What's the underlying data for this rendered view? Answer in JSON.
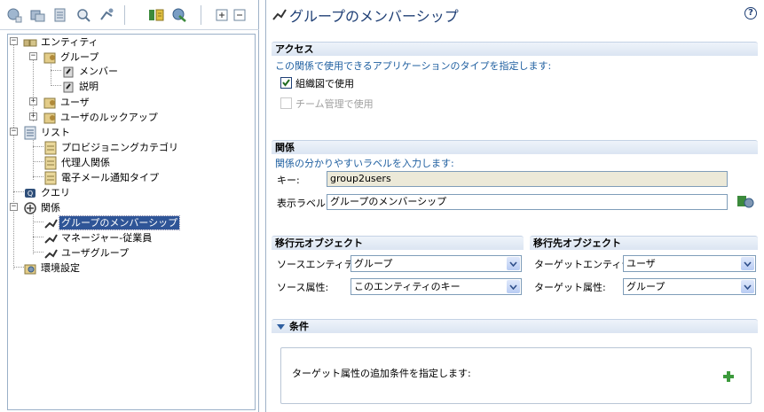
{
  "colors": {
    "accent": "#1f3f75",
    "selection": "#2f5597",
    "desc_text": "#1f5fa0",
    "readonly_bg": "#ece9d8"
  },
  "toolbar": {
    "icons": [
      "new-entity-icon",
      "new-group-icon",
      "new-list-icon",
      "new-query-icon",
      "new-relation-icon",
      "import-icon",
      "export-icon",
      "expand-all-icon",
      "collapse-all-icon"
    ]
  },
  "tree": {
    "entities": "エンティティ",
    "group": "グループ",
    "member": "メンバー",
    "description": "説明",
    "user": "ユーザ",
    "user_lookup": "ユーザのルックアップ",
    "lists": "リスト",
    "provisioning_category": "プロビジョニングカテゴリ",
    "delegate_relation": "代理人関係",
    "email_notification_type": "電子メール通知タイプ",
    "query": "クエリ",
    "relations": "関係",
    "group_membership": "グループのメンバーシップ",
    "manager_employee": "マネージャー-従業員",
    "user_group": "ユーザグループ",
    "environment_settings": "環境設定"
  },
  "header": {
    "title": "グループのメンバーシップ",
    "help": "?"
  },
  "access": {
    "title": "アクセス",
    "description": "この関係で使用できるアプリケーションのタイプを指定します:",
    "org_chart_label": "組織図で使用",
    "org_chart_checked": true,
    "team_mgmt_label": "チーム管理で使用",
    "team_mgmt_checked": false
  },
  "relation": {
    "title": "関係",
    "description": "関係の分かりやすいラベルを入力します:",
    "key_label": "キー:",
    "key_value": "group2users",
    "display_label": "表示ラベル:",
    "display_value": "グループのメンバーシップ"
  },
  "source": {
    "title": "移行元オブジェクト",
    "entity_label": "ソースエンティティ:",
    "entity_value": "グループ",
    "attr_label": "ソース属性:",
    "attr_value": "このエンティティのキー"
  },
  "target": {
    "title": "移行先オブジェクト",
    "entity_label": "ターゲットエンティティ:",
    "entity_value": "ユーザ",
    "attr_label": "ターゲット属性:",
    "attr_value": "グループ"
  },
  "conditions": {
    "title": "条件",
    "description": "ターゲット属性の追加条件を指定します:"
  }
}
